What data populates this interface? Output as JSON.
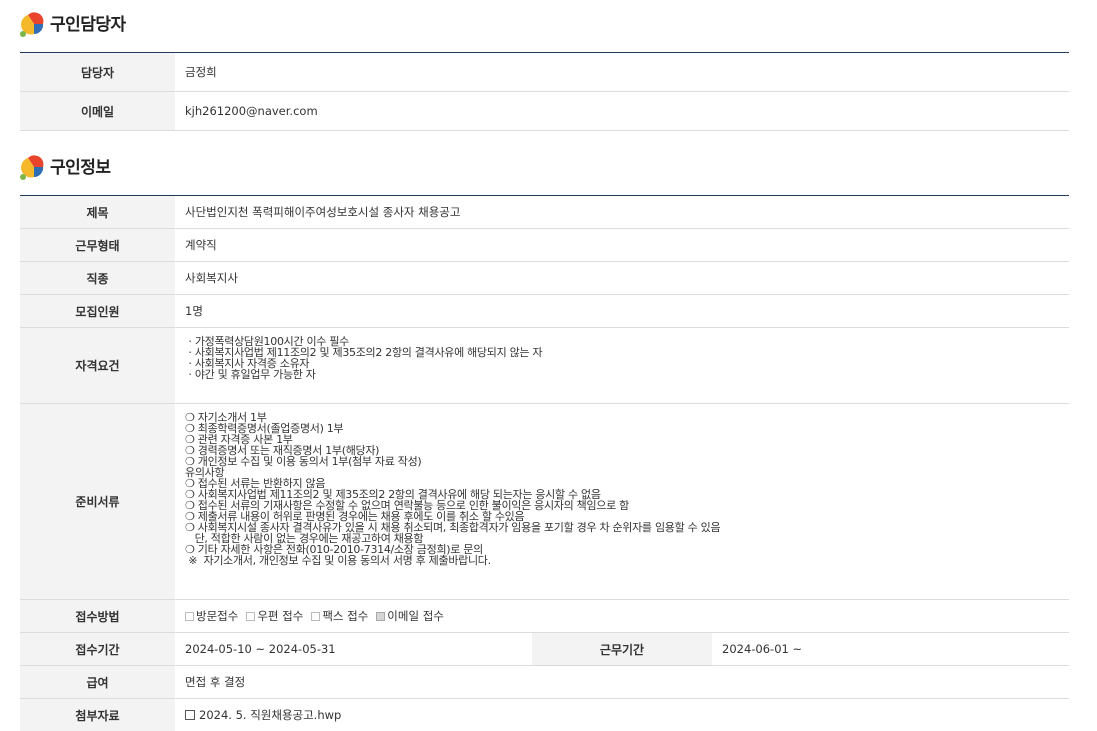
{
  "contact_section": {
    "title": "구인담당자",
    "rows": [
      {
        "label": "담당자",
        "value": "금정희"
      },
      {
        "label": "이메일",
        "value": "kjh261200@naver.com"
      }
    ]
  },
  "job_section": {
    "title": "구인정보",
    "subject": {
      "label": "제목",
      "value": "사단법인지천 폭력피해이주여성보호시설 종사자 채용공고"
    },
    "employment_type": {
      "label": "근무형태",
      "value": "계약직"
    },
    "job_category": {
      "label": "직종",
      "value": "사회복지사"
    },
    "headcount": {
      "label": "모집인원",
      "value": "1명"
    },
    "qualifications": {
      "label": "자격요건",
      "lines": [
        "ㆍ가정폭력상담원100시간 이수 필수",
        "ㆍ사회복지사업법 제11조의2 및 제35조의2 2항의 결격사유에 해당되지 않는 자",
        "ㆍ사회복지사 자격증 소유자",
        "ㆍ야간 및 휴일업무 가능한 자"
      ]
    },
    "documents": {
      "label": "준비서류",
      "lines": [
        "❍ 자기소개서 1부",
        "❍ 최종학력증명서(졸업증명서) 1부",
        "❍ 관련 자격증 사본 1부",
        "❍ 경력증명서 또는 재직증명서 1부(해당자)",
        "❍ 개인정보 수집 및 이용 동의서 1부(첨부 자료 작성)",
        "",
        "유의사항",
        "❍ 접수된 서류는 반환하지 않음",
        "❍ 사회복지사업법 제11조의2 및 제35조의2 2항의 결격사유에 해당 되는자는 응시할 수 없음",
        "❍ 접수된 서류의 기재사항은 수정할 수 없으며 연락불능 등으로 인한 불이익은 응시자의 책임으로 함",
        "❍ 제출서류 내용이 허위로 판명된 경우에는 채용 후에도 이를 취소 할 수있음",
        "❍ 사회복지시설 종사자 결격사유가 있을 시 채용 취소되며, 최종합격자가 임용을 포기할 경우 차 순위자를 임용할 수 있음",
        "   단, 적합한 사람이 없는 경우에는 재공고하여 채용함",
        "❍ 기타 자세한 사항은 전화(010-2010-7314/소장 금정희)로 문의",
        " ※  자기소개서, 개인정보 수집 및 이용 동의서 서명 후 제출바랍니다."
      ]
    },
    "application_method": {
      "label": "접수방법",
      "options": [
        {
          "label": "방문접수",
          "checked": false
        },
        {
          "label": "우편 접수",
          "checked": false
        },
        {
          "label": "팩스 접수",
          "checked": false
        },
        {
          "label": "이메일 접수",
          "checked": true
        }
      ]
    },
    "application_period": {
      "label": "접수기간",
      "value": "2024-05-10 ~ 2024-05-31"
    },
    "work_period": {
      "label": "근무기간",
      "value": "2024-06-01 ~"
    },
    "salary": {
      "label": "급여",
      "value": "면접 후 결정"
    },
    "attachment": {
      "label": "첨부자료",
      "value": "2024. 5. 직원채용공고.hwp"
    }
  },
  "colors": {
    "header_bg": "#f3f3f3",
    "top_border": "#1f3a5a",
    "logo_red": "#e9452d",
    "logo_yellow": "#f5b82a",
    "logo_blue": "#2f6db5",
    "logo_green": "#7ab648"
  }
}
